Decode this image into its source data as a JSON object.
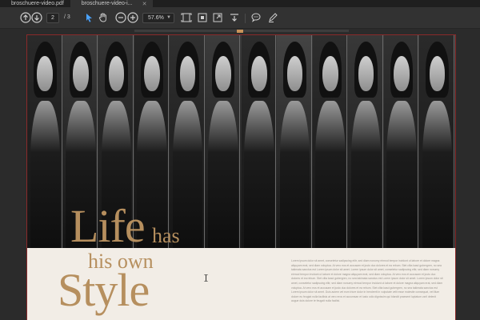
{
  "tabs": [
    {
      "label": "broschuere-video.pdf",
      "active": false
    },
    {
      "label": "broschuere-video-i...",
      "active": true
    }
  ],
  "toolbar": {
    "current_page": "2",
    "total_pages": "/ 3",
    "zoom": "57.6%"
  },
  "document": {
    "headline_life": "Life",
    "headline_has": "has",
    "headline_his": "his own",
    "headline_style": "Style",
    "body_text": "Lorem ipsum dolor sit amet, consetetur sadipscing elitr, sed diam nonumy eirmod tempor invidunt ut labore et dolore magna aliquyam erat, sed diam voluptua. At vero eos et accusam et justo duo dolores et ea rebum. Stet clita kasd gubergren, no sea takimata sanctus est Lorem ipsum dolor sit amet. Lorem ipsum dolor sit amet, consetetur sadipscing elitr, sed diam nonumy eirmod tempor invidunt ut labore et dolore magna aliquyam erat, sed diam voluptua. At vero eos et accusam et justo duo dolores et ea rebum. Stet clita kasd gubergren, no sea takimata sanctus est Lorem ipsum dolor sit amet. Lorem ipsum dolor sit amet, consetetur sadipscing elitr, sed diam nonumy eirmod tempor invidunt ut labore et dolore magna aliquyam erat, sed diam voluptua. At vero eos et accusam et justo duo dolores et ea rebum. Stet clita kasd gubergren, no sea takimata sanctus est Lorem ipsum dolor sit amet. Duis autem vel eum iriure dolor in hendrerit in vulputate velit esse molestie consequat, vel illum dolore eu feugiat nulla facilisis at vero eros et accumsan et iusto odio dignissim qui blandit praesent luptatum zzril delenit augue duis dolore te feugait nulla facilisi."
  },
  "colors": {
    "accent_gold": "#b68f5e",
    "page_border": "#8a2a2a",
    "toolbar_bg": "#323232"
  }
}
